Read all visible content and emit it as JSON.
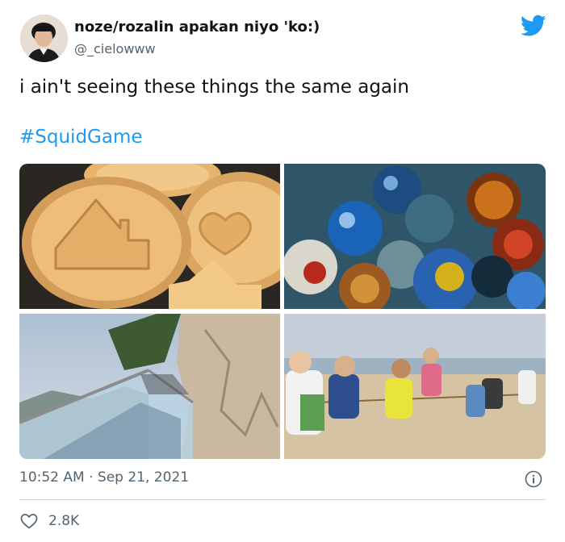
{
  "author": {
    "display_name": "noze/rozalin apakan niyo 'ko:)",
    "handle": "@_cielowww"
  },
  "tweet": {
    "text": "i ain't seeing these things the same again",
    "hashtag": "#SquidGame"
  },
  "media": [
    {
      "subject": "dalgona-cookies"
    },
    {
      "subject": "glass-marbles"
    },
    {
      "subject": "glass-bridge-walkway"
    },
    {
      "subject": "tug-of-war"
    }
  ],
  "meta": {
    "time": "10:52 AM",
    "separator": "·",
    "date": "Sep 21, 2021"
  },
  "engagement": {
    "likes": "2.8K"
  },
  "colors": {
    "accent": "#1d9bf0",
    "muted": "#536471",
    "text": "#0f1419",
    "divider": "#cfd9de"
  },
  "icons": [
    "twitter-bird-icon",
    "info-icon",
    "heart-icon"
  ]
}
